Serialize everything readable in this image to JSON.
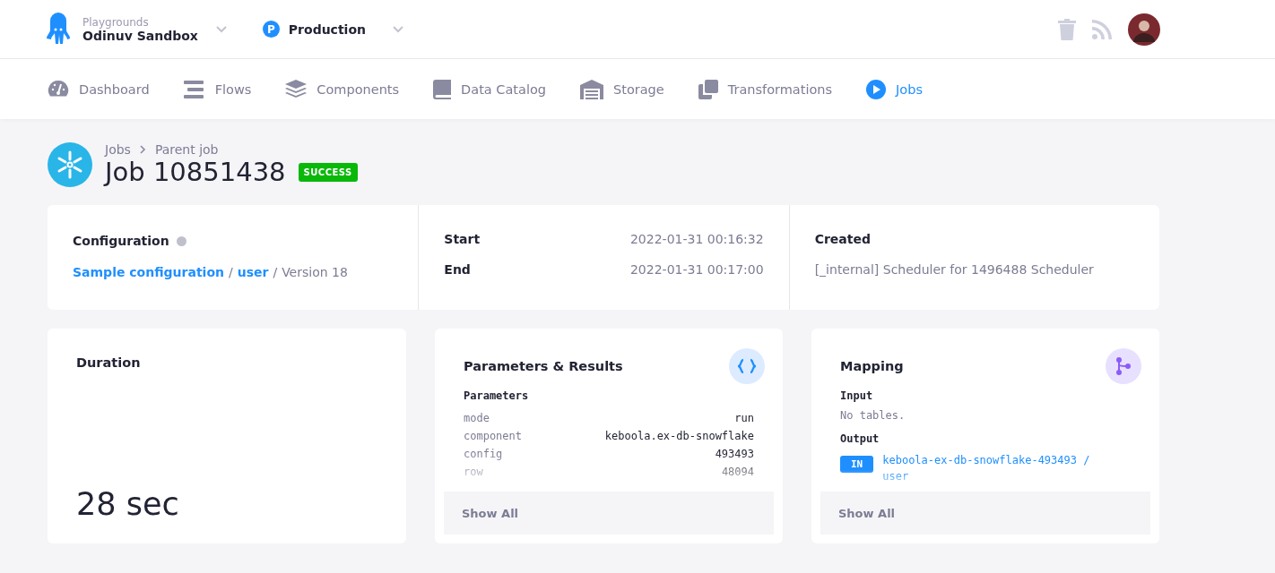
{
  "header": {
    "project_label": "Playgrounds",
    "project_name": "Odinuv Sandbox",
    "branch_badge": "P",
    "branch": "Production"
  },
  "nav": [
    {
      "label": "Dashboard",
      "kind": "gauge",
      "selected": false
    },
    {
      "label": "Flows",
      "kind": "bars",
      "selected": false
    },
    {
      "label": "Components",
      "kind": "layers",
      "selected": false
    },
    {
      "label": "Data Catalog",
      "kind": "book",
      "selected": false
    },
    {
      "label": "Storage",
      "kind": "warehouse",
      "selected": false
    },
    {
      "label": "Transformations",
      "kind": "copy",
      "selected": false
    },
    {
      "label": "Jobs",
      "kind": "play",
      "selected": true
    }
  ],
  "breadcrumbs": [
    "Jobs",
    "Parent job"
  ],
  "title": "Job 10851438",
  "status": "SUCCESS",
  "info": {
    "configuration": {
      "label": "Configuration",
      "config_link": "Sample configuration",
      "separator": "/",
      "row_link": "user",
      "separator_2": "/",
      "version": "Version 18"
    },
    "times": [
      {
        "label": "Start",
        "value": "2022-01-31 00:16:32"
      },
      {
        "label": "End",
        "value": "2022-01-31 00:17:00"
      }
    ],
    "created": {
      "label": "Created",
      "value": "[_internal] Scheduler for 1496488 Scheduler"
    }
  },
  "duration": {
    "title": "Duration",
    "value": "28 sec"
  },
  "parameters": {
    "title": "Parameters & Results",
    "subtitle": "Parameters",
    "rows": [
      {
        "key": "mode",
        "value": "run"
      },
      {
        "key": "component",
        "value": "keboola.ex-db-snowflake"
      },
      {
        "key": "config",
        "value": "493493"
      },
      {
        "key": "row",
        "value": "48094"
      }
    ],
    "show_all": "Show All"
  },
  "mapping": {
    "title": "Mapping",
    "input_label": "Input",
    "input_empty": "No tables.",
    "output_label": "Output",
    "outputs": [
      {
        "badge": "IN",
        "table": "keboola-ex-db-snowflake-493493 / user"
      }
    ],
    "show_all": "Show All"
  }
}
